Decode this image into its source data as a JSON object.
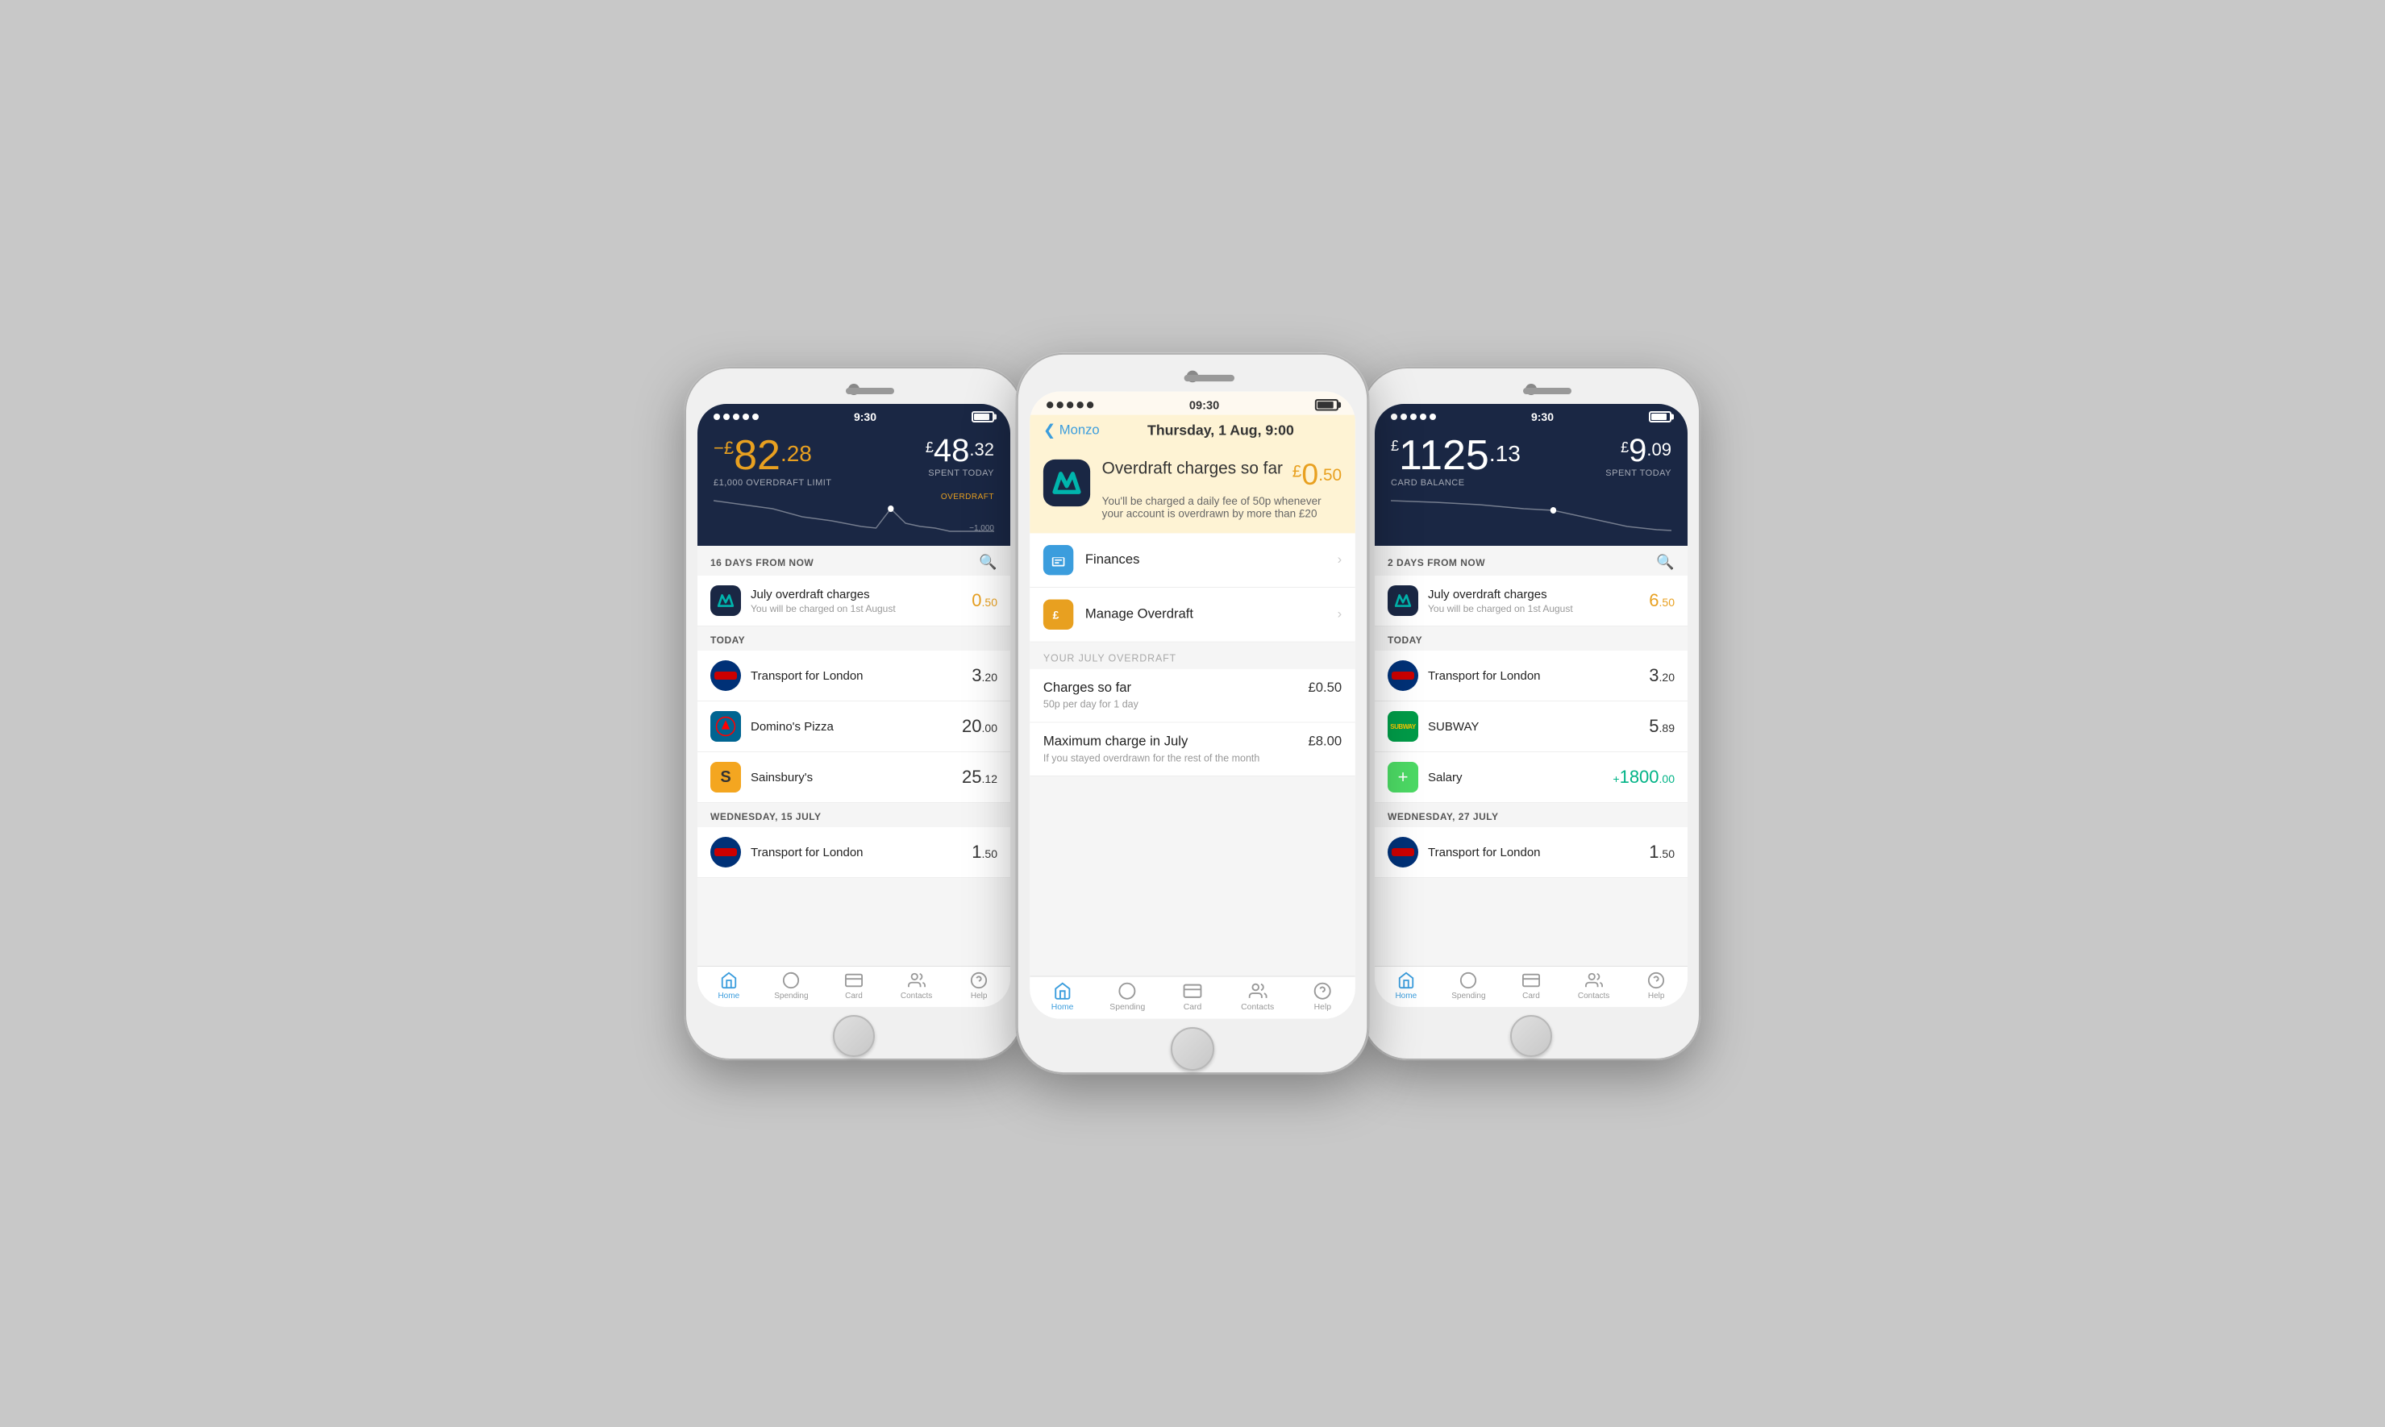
{
  "phones": {
    "left": {
      "status": {
        "time": "9:30"
      },
      "header": {
        "balance_prefix": "−£",
        "balance_integer": "82",
        "balance_decimal": ".28",
        "balance_label": "£1,000 OVERDRAFT LIMIT",
        "spent_amount": "£48",
        "spent_decimal": ".32",
        "spent_label": "SPENT TODAY",
        "overdraft_tag": "OVERDRAFT",
        "overdraft_bottom": "−1,000"
      },
      "days_label": "16 DAYS FROM NOW",
      "overdraft_item": {
        "name": "July overdraft charges",
        "sub": "You will be charged on 1st August",
        "amount": "0",
        "decimal": ".50",
        "amount_full": "0.50"
      },
      "today_label": "TODAY",
      "today_items": [
        {
          "name": "Transport for London",
          "integer": "3",
          "decimal": ".20"
        },
        {
          "name": "Domino's Pizza",
          "integer": "20",
          "decimal": ".00"
        },
        {
          "name": "Sainsbury's",
          "integer": "25",
          "decimal": ".12"
        }
      ],
      "wed_label": "WEDNESDAY, 15 JULY",
      "wed_items": [
        {
          "name": "Transport for London",
          "integer": "1",
          "decimal": ".50"
        }
      ]
    },
    "middle": {
      "status": {
        "time": "09:30"
      },
      "back_label": "Monzo",
      "nav_title": "Thursday, 1 Aug, 9:00",
      "overdraft_title": "Overdraft charges so far",
      "overdraft_amount": "£0",
      "overdraft_amount_decimal": ".50",
      "overdraft_sub": "You'll be charged a daily fee of 50p whenever your account is overdrawn by more than £20",
      "menu_items": [
        {
          "label": "Finances",
          "icon_color": "#3b9ddd"
        },
        {
          "label": "Manage Overdraft",
          "icon_color": "#e8a020"
        }
      ],
      "section_label": "YOUR JULY OVERDRAFT",
      "charges": [
        {
          "label": "Charges so far",
          "sub": "50p per day for 1 day",
          "amount": "£0.50"
        },
        {
          "label": "Maximum charge in July",
          "sub": "If you stayed overdrawn for the rest of the month",
          "amount": "£8.00"
        }
      ]
    },
    "right": {
      "status": {
        "time": "9:30"
      },
      "header": {
        "balance_prefix": "£",
        "balance_integer": "1125",
        "balance_decimal": ".13",
        "balance_label": "CARD BALANCE",
        "spent_amount": "£9",
        "spent_decimal": ".09",
        "spent_label": "SPENT TODAY"
      },
      "days_label": "2 DAYS FROM NOW",
      "overdraft_item": {
        "name": "July overdraft charges",
        "sub": "You will be charged on 1st August",
        "amount": "6",
        "decimal": ".50",
        "amount_full": "6.50"
      },
      "today_label": "TODAY",
      "today_items": [
        {
          "name": "Transport for London",
          "integer": "3",
          "decimal": ".20"
        },
        {
          "name": "SUBWAY",
          "integer": "5",
          "decimal": ".89"
        },
        {
          "name": "Salary",
          "integer": "1800",
          "decimal": ".00",
          "plus": true
        }
      ],
      "wed_label": "WEDNESDAY, 27 JULY",
      "wed_items": [
        {
          "name": "Transport for London",
          "integer": "1",
          "decimal": ".50"
        }
      ]
    }
  },
  "nav": {
    "items": [
      "Home",
      "Spending",
      "Card",
      "Contacts",
      "Help"
    ]
  }
}
